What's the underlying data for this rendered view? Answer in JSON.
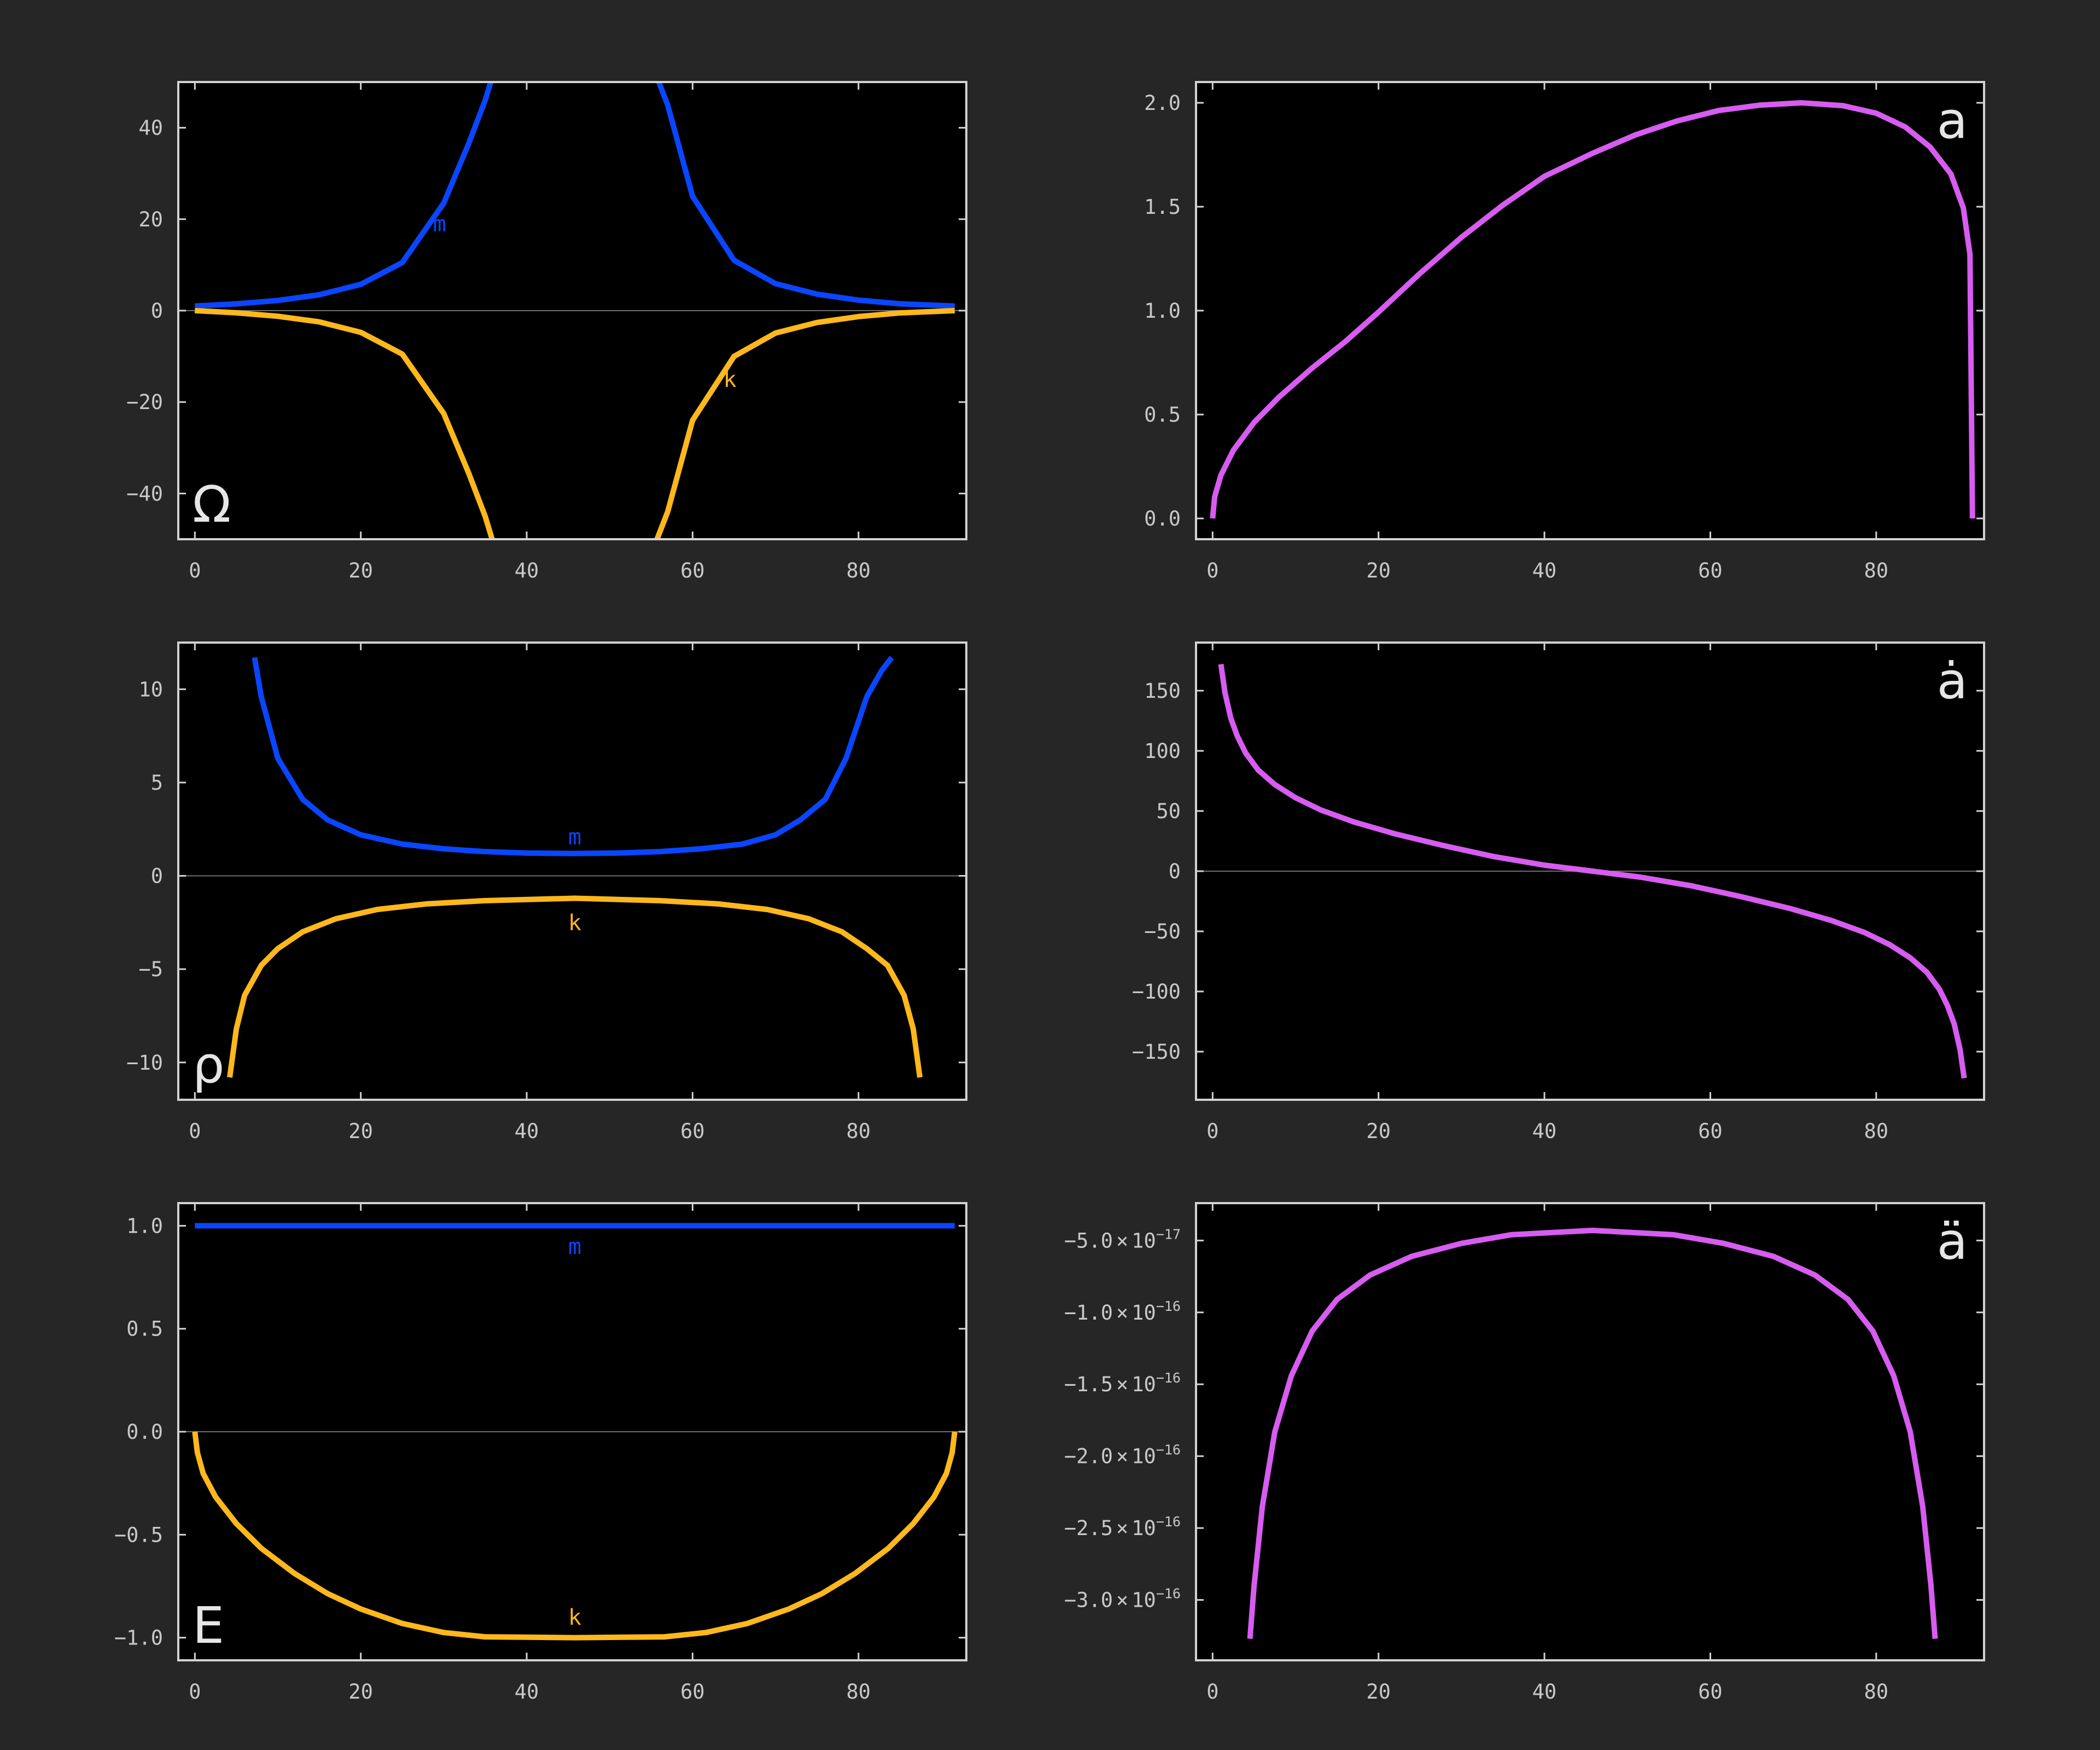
{
  "colors": {
    "background": "#262626",
    "plot_background": "#000000",
    "frame": "#d2d2d2",
    "zero_line": "#6e6e6e",
    "m": "#0a46ff",
    "k": "#ffb81c",
    "a": "#d75cf0",
    "tick_text": "#c8c8c8"
  },
  "chart_data": [
    {
      "type": "line",
      "panel_label": "Ω",
      "xlim": [
        -2,
        93
      ],
      "ylim": [
        -50,
        50
      ],
      "x_ticks": [
        0,
        20,
        40,
        60,
        80
      ],
      "x_tick_labels": [
        "0",
        "20",
        "40",
        "60",
        "80"
      ],
      "y_ticks": [
        40,
        20,
        0,
        -20,
        -40
      ],
      "y_tick_labels": [
        "40",
        "20",
        "0",
        "−20",
        "−40"
      ],
      "zero_line": true,
      "series": [
        {
          "name": "m",
          "color": "#0a46ff",
          "x": [
            0,
            5,
            10,
            15,
            20,
            25,
            30,
            33,
            35,
            36,
            37,
            37.7,
            53.7,
            54.5,
            55.5,
            57,
            60,
            65,
            70,
            75,
            80,
            85,
            91.6
          ],
          "y": [
            1.0,
            1.48,
            2.23,
            3.47,
            5.75,
            10.5,
            23.5,
            36.5,
            46.0,
            52.0,
            60.0,
            66.0,
            66.0,
            59.0,
            52.0,
            45.0,
            25.0,
            11.0,
            5.9,
            3.6,
            2.3,
            1.5,
            1.0
          ]
        },
        {
          "name": "k",
          "color": "#ffb81c",
          "x": [
            0,
            5,
            10,
            15,
            20,
            25,
            30,
            33,
            35,
            36,
            37,
            37.7,
            53.7,
            54.5,
            55.5,
            57,
            60,
            65,
            70,
            75,
            80,
            85,
            91.6
          ],
          "y": [
            0.0,
            -0.48,
            -1.23,
            -2.47,
            -4.75,
            -9.5,
            -22.5,
            -35.5,
            -45.0,
            -51.0,
            -59.0,
            -65.0,
            -65.0,
            -58.0,
            -51.0,
            -44.0,
            -24.0,
            -10.0,
            -4.9,
            -2.6,
            -1.3,
            -0.5,
            0.0
          ]
        }
      ],
      "annotations": [
        {
          "text": "m",
          "series": "m",
          "x": 29.5,
          "y": 19
        },
        {
          "text": "k",
          "series": "k",
          "x": 64.5,
          "y": -15
        }
      ]
    },
    {
      "type": "line",
      "panel_label": "a",
      "xlim": [
        -2,
        93
      ],
      "ylim": [
        -0.1,
        2.1
      ],
      "x_ticks": [
        0,
        20,
        40,
        60,
        80
      ],
      "x_tick_labels": [
        "0",
        "20",
        "40",
        "60",
        "80"
      ],
      "y_ticks": [
        2.0,
        1.5,
        1.0,
        0.5,
        0.0
      ],
      "y_tick_labels": [
        "2.0",
        "1.5",
        "1.0",
        "0.5",
        "0.0"
      ],
      "zero_line": false,
      "series": [
        {
          "name": "a",
          "color": "#d75cf0",
          "x": [
            0,
            0.25,
            1,
            2.5,
            5,
            8,
            12,
            16,
            20,
            25,
            30,
            35,
            40,
            45.8,
            51,
            56,
            61,
            66,
            71,
            76,
            80,
            83.5,
            86.5,
            89,
            90.5,
            91.3,
            91.6
          ],
          "y": [
            0.0,
            0.104,
            0.208,
            0.328,
            0.462,
            0.584,
            0.724,
            0.851,
            0.993,
            1.179,
            1.353,
            1.508,
            1.646,
            1.757,
            1.846,
            1.913,
            1.963,
            1.989,
            2.0,
            1.986,
            1.95,
            1.884,
            1.787,
            1.658,
            1.494,
            1.271,
            0.0
          ]
        }
      ]
    },
    {
      "type": "line",
      "panel_label": "ρ",
      "xlim": [
        -2,
        93
      ],
      "ylim": [
        -12,
        12.5
      ],
      "x_ticks": [
        0,
        20,
        40,
        60,
        80
      ],
      "x_tick_labels": [
        "0",
        "20",
        "40",
        "60",
        "80"
      ],
      "y_ticks": [
        10,
        5,
        0,
        -5,
        -10
      ],
      "y_tick_labels": [
        "10",
        "5",
        "0",
        "−5",
        "−10"
      ],
      "zero_line": true,
      "series": [
        {
          "name": "m",
          "color": "#0a46ff",
          "x": [
            7.2,
            8,
            10,
            13,
            16,
            20,
            25,
            30,
            35,
            40,
            45.8,
            51,
            56,
            61,
            66,
            70,
            73,
            76,
            78.5,
            81,
            82.8,
            84
          ],
          "y": [
            11.7,
            9.6,
            6.3,
            4.1,
            3.0,
            2.2,
            1.7,
            1.45,
            1.3,
            1.22,
            1.2,
            1.22,
            1.3,
            1.45,
            1.7,
            2.2,
            3.0,
            4.1,
            6.3,
            9.6,
            11.0,
            11.7
          ]
        },
        {
          "name": "k",
          "color": "#ffb81c",
          "x": [
            4.2,
            5,
            6,
            8,
            10,
            13,
            17,
            22,
            28,
            35,
            45.8,
            56,
            63,
            69,
            74,
            78,
            81,
            83.5,
            85.5,
            86.6,
            87.4
          ],
          "y": [
            -10.8,
            -8.2,
            -6.4,
            -4.8,
            -3.9,
            -3.0,
            -2.3,
            -1.8,
            -1.5,
            -1.33,
            -1.2,
            -1.33,
            -1.5,
            -1.8,
            -2.3,
            -3.0,
            -3.9,
            -4.8,
            -6.4,
            -8.2,
            -10.8
          ]
        }
      ],
      "annotations": [
        {
          "text": "m",
          "series": "m",
          "x": 45.8,
          "y": 2.1
        },
        {
          "text": "k",
          "series": "k",
          "x": 45.8,
          "y": -2.5
        }
      ]
    },
    {
      "type": "line",
      "panel_label": "ȧ",
      "xlim": [
        -2,
        93
      ],
      "ylim": [
        -190,
        190
      ],
      "x_ticks": [
        0,
        20,
        40,
        60,
        80
      ],
      "x_tick_labels": [
        "0",
        "20",
        "40",
        "60",
        "80"
      ],
      "y_ticks": [
        150,
        100,
        50,
        0,
        -50,
        -100,
        -150
      ],
      "y_tick_labels": [
        "150",
        "100",
        "50",
        "0",
        "−50",
        "−100",
        "−150"
      ],
      "zero_line": true,
      "series": [
        {
          "name": "a",
          "color": "#d75cf0",
          "x": [
            1,
            1.5,
            2.2,
            3,
            4,
            5.5,
            7.5,
            10,
            13,
            17,
            22,
            28,
            34,
            40,
            45.8,
            51.6,
            57.6,
            63.6,
            69.6,
            74.6,
            78.6,
            81.6,
            84.1,
            86.1,
            87.6,
            88.6,
            89.4,
            90.1,
            90.6
          ],
          "y": [
            172,
            148,
            127,
            112,
            98,
            84,
            72,
            61,
            51,
            41,
            31,
            21,
            12,
            5,
            0,
            -5,
            -12,
            -21,
            -31,
            -41,
            -51,
            -61,
            -72,
            -84,
            -98,
            -112,
            -127,
            -148,
            -172
          ]
        }
      ]
    },
    {
      "type": "line",
      "panel_label": "E",
      "xlim": [
        -2,
        93
      ],
      "ylim": [
        -1.11,
        1.11
      ],
      "x_ticks": [
        0,
        20,
        40,
        60,
        80
      ],
      "x_tick_labels": [
        "0",
        "20",
        "40",
        "60",
        "80"
      ],
      "y_ticks": [
        1.0,
        0.5,
        0.0,
        -0.5,
        -1.0
      ],
      "y_tick_labels": [
        "1.0",
        "0.5",
        "0.0",
        "−0.5",
        "−1.0"
      ],
      "zero_line": true,
      "series": [
        {
          "name": "m",
          "color": "#0a46ff",
          "x": [
            0,
            91.6
          ],
          "y": [
            1.0,
            1.0
          ]
        },
        {
          "name": "k",
          "color": "#ffb81c",
          "x": [
            0,
            0.3,
            1,
            2.5,
            5,
            8,
            12,
            16,
            20,
            25,
            30,
            35,
            40,
            45.8,
            51.6,
            56.6,
            61.6,
            66.6,
            71.6,
            75.6,
            79.6,
            83.6,
            86.6,
            89.1,
            90.6,
            91.3,
            91.6
          ],
          "y": [
            0.0,
            -0.101,
            -0.203,
            -0.317,
            -0.446,
            -0.566,
            -0.688,
            -0.786,
            -0.861,
            -0.931,
            -0.975,
            -0.996,
            -0.998,
            -1.0,
            -0.998,
            -0.996,
            -0.975,
            -0.931,
            -0.861,
            -0.786,
            -0.688,
            -0.566,
            -0.446,
            -0.317,
            -0.203,
            -0.101,
            0.0
          ]
        }
      ],
      "annotations": [
        {
          "text": "m",
          "series": "m",
          "x": 45.8,
          "y": 0.9
        },
        {
          "text": "k",
          "series": "k",
          "x": 45.8,
          "y": -0.9
        }
      ]
    },
    {
      "type": "line",
      "panel_label": "ä",
      "xlim": [
        -2,
        93
      ],
      "ylim": [
        -3.42e-16,
        -2.4e-17
      ],
      "x_ticks": [
        0,
        20,
        40,
        60,
        80
      ],
      "x_tick_labels": [
        "0",
        "20",
        "40",
        "60",
        "80"
      ],
      "y_ticks": [
        -5e-17,
        -1e-16,
        -1.5e-16,
        -2e-16,
        -2.5e-16,
        -3e-16
      ],
      "y_tick_labels": [
        {
          "mantissa": "−5.0",
          "times": "×",
          "base": "10",
          "exp": "−17"
        },
        {
          "mantissa": "−1.0",
          "times": "×",
          "base": "10",
          "exp": "−16"
        },
        {
          "mantissa": "−1.5",
          "times": "×",
          "base": "10",
          "exp": "−16"
        },
        {
          "mantissa": "−2.0",
          "times": "×",
          "base": "10",
          "exp": "−16"
        },
        {
          "mantissa": "−2.5",
          "times": "×",
          "base": "10",
          "exp": "−16"
        },
        {
          "mantissa": "−3.0",
          "times": "×",
          "base": "10",
          "exp": "−16"
        }
      ],
      "zero_line": false,
      "series": [
        {
          "name": "a",
          "color": "#d75cf0",
          "x": [
            4.5,
            5,
            6,
            7.5,
            9.5,
            12,
            15,
            19,
            24,
            30,
            36,
            45.8,
            55.6,
            61.6,
            67.6,
            72.6,
            76.6,
            79.6,
            82.1,
            84.1,
            85.6,
            86.6,
            87.1
          ],
          "y": [
            -3.27e-16,
            -2.9e-16,
            -2.35e-16,
            -1.83e-16,
            -1.44e-16,
            -1.13e-16,
            -9.1e-17,
            -7.4e-17,
            -6.1e-17,
            -5.2e-17,
            -4.6e-17,
            -4.3e-17,
            -4.6e-17,
            -5.2e-17,
            -6.1e-17,
            -7.4e-17,
            -9.1e-17,
            -1.13e-16,
            -1.44e-16,
            -1.83e-16,
            -2.35e-16,
            -2.9e-16,
            -3.27e-16
          ]
        }
      ]
    }
  ]
}
